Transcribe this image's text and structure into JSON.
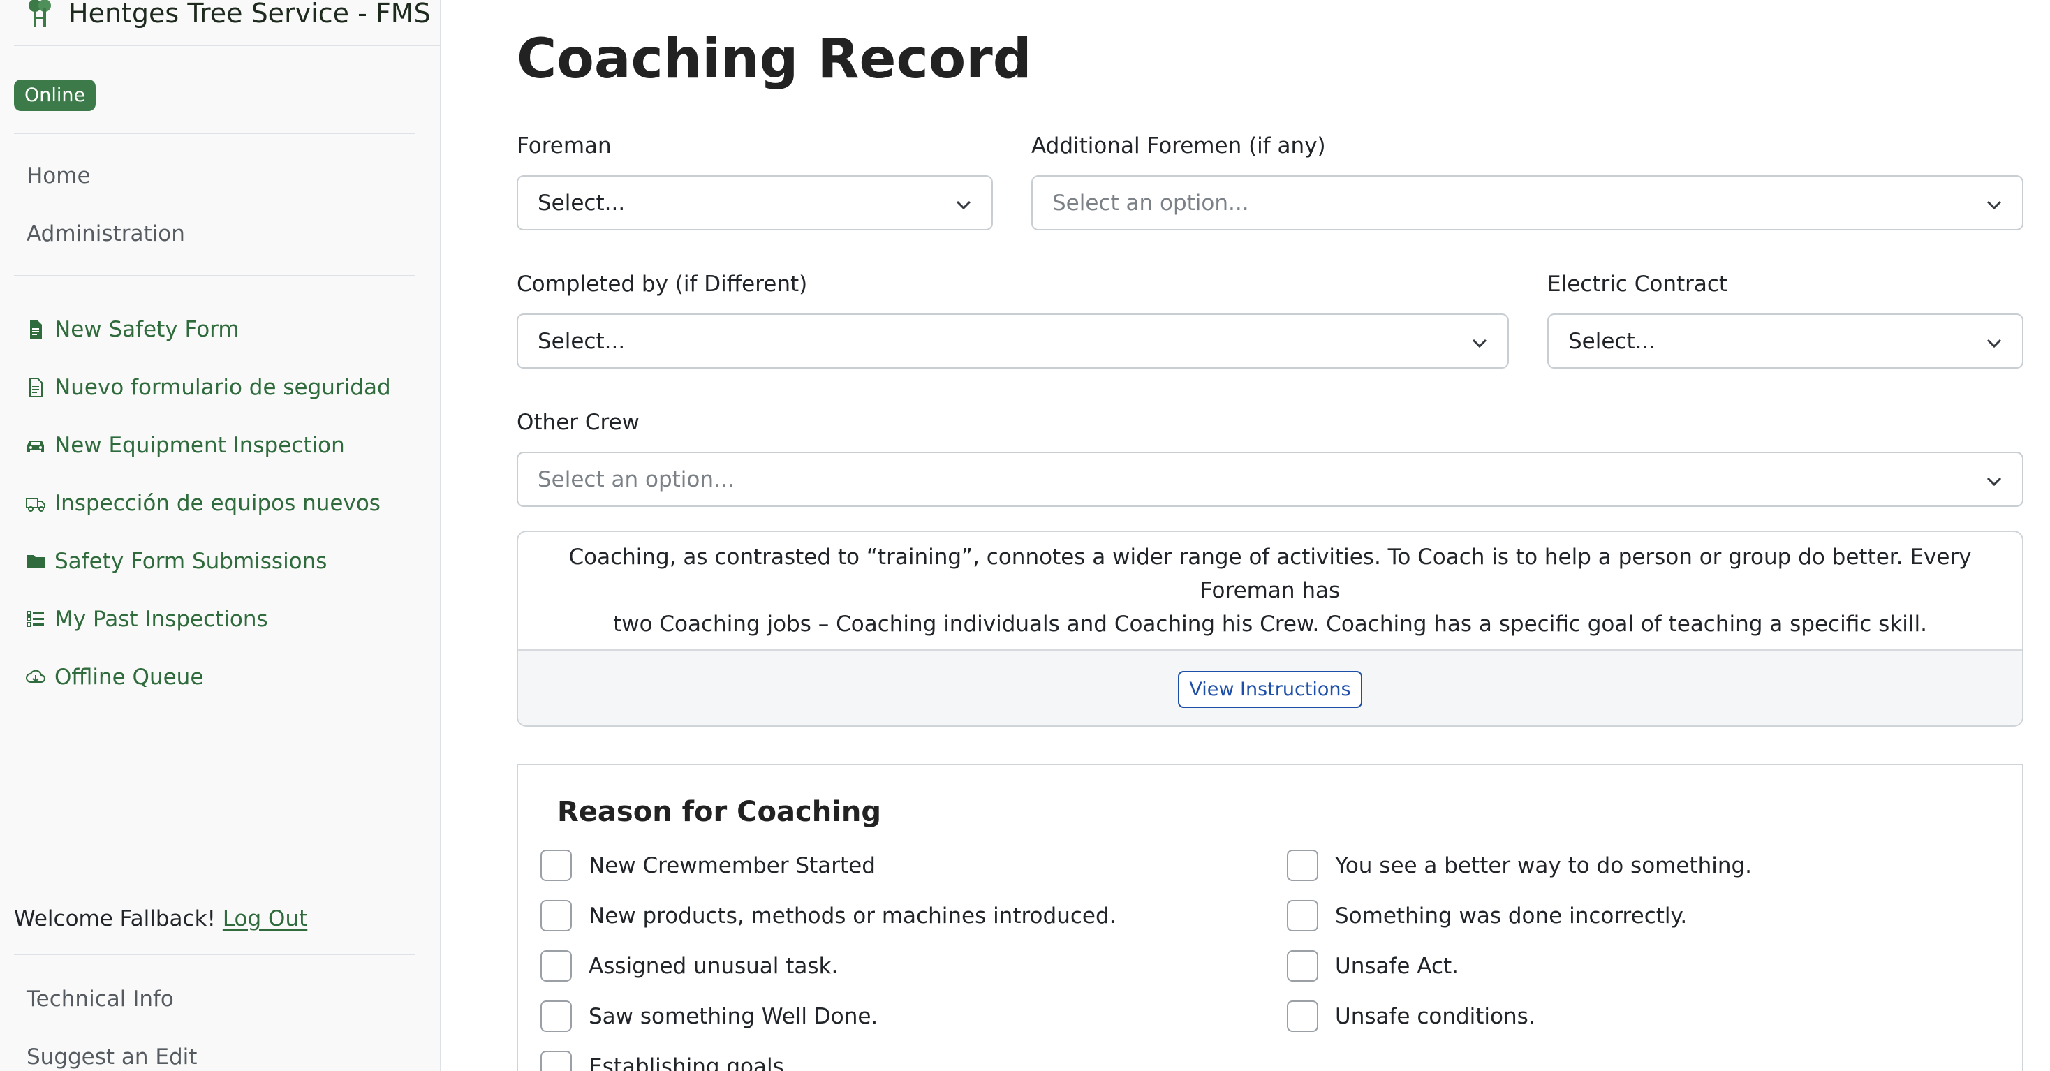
{
  "app": {
    "title": "Hentges Tree Service - FMS",
    "status": "Online"
  },
  "sidebar": {
    "nav": [
      {
        "label": "Home"
      },
      {
        "label": "Administration"
      }
    ],
    "forms": [
      {
        "label": "New Safety Form",
        "icon": "file-filled-icon"
      },
      {
        "label": "Nuevo formulario de seguridad",
        "icon": "file-outline-icon"
      },
      {
        "label": "New Equipment Inspection",
        "icon": "car-icon"
      },
      {
        "label": "Inspección de equipos nuevos",
        "icon": "truck-icon"
      },
      {
        "label": "Safety Form Submissions",
        "icon": "folder-icon"
      },
      {
        "label": "My Past Inspections",
        "icon": "list-check-icon"
      },
      {
        "label": "Offline Queue",
        "icon": "cloud-download-icon"
      }
    ],
    "welcome": "Welcome Fallback!",
    "logout": "Log Out",
    "footer": [
      {
        "label": "Technical Info"
      },
      {
        "label": "Suggest an Edit"
      }
    ]
  },
  "form": {
    "title": "Coaching Record",
    "foreman": {
      "label": "Foreman",
      "value": "Select..."
    },
    "additional_foremen": {
      "label": "Additional Foremen (if any)",
      "placeholder": "Select an option..."
    },
    "completed_by": {
      "label": "Completed by (if Different)",
      "value": "Select..."
    },
    "electric_contract": {
      "label": "Electric Contract",
      "value": "Select..."
    },
    "other_crew": {
      "label": "Other Crew",
      "placeholder": "Select an option..."
    },
    "info": {
      "line1": "Coaching, as contrasted to “training”, connotes a wider range of activities. To Coach is to help a person or group do better. Every Foreman has",
      "line2": "two Coaching jobs – Coaching individuals and Coaching his Crew. Coaching has a specific goal of teaching a specific skill.",
      "button": "View Instructions"
    },
    "reasons": {
      "title": "Reason for Coaching",
      "left": [
        {
          "label": "New Crewmember Started"
        },
        {
          "label": "New products, methods or machines introduced."
        },
        {
          "label": "Assigned unusual task."
        },
        {
          "label": "Saw something Well Done."
        },
        {
          "label": "Establishing goals"
        }
      ],
      "right": [
        {
          "label": "You see a better way to do something."
        },
        {
          "label": "Something was done incorrectly."
        },
        {
          "label": "Unsafe Act."
        },
        {
          "label": "Unsafe conditions."
        }
      ]
    }
  },
  "colors": {
    "accent_green": "#2f6b3c",
    "badge_green": "#3d7a4a",
    "link_blue": "#1e4fa8"
  }
}
